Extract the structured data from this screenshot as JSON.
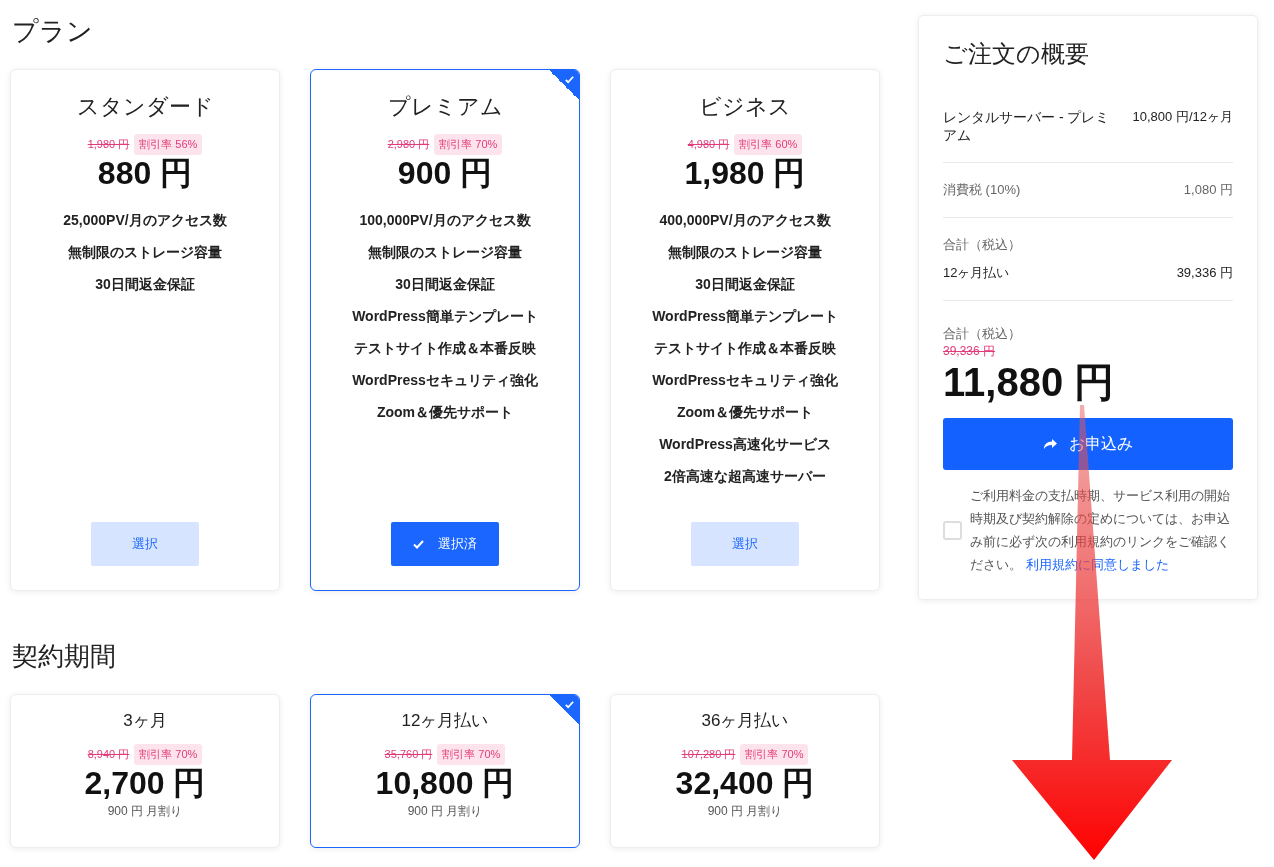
{
  "plan_section": {
    "title": "プラン",
    "plans": [
      {
        "name": "スタンダード",
        "old_price": "1,980 円",
        "discount": "割引率 56%",
        "price": "880 円",
        "features": [
          "25,000PV/月のアクセス数",
          "無制限のストレージ容量",
          "30日間返金保証"
        ],
        "button": "選択",
        "selected": false
      },
      {
        "name": "プレミアム",
        "old_price": "2,980 円",
        "discount": "割引率 70%",
        "price": "900 円",
        "features": [
          "100,000PV/月のアクセス数",
          "無制限のストレージ容量",
          "30日間返金保証",
          "WordPress簡単テンプレート",
          "テストサイト作成＆本番反映",
          "WordPressセキュリティ強化",
          "Zoom＆優先サポート"
        ],
        "button": "選択済",
        "selected": true
      },
      {
        "name": "ビジネス",
        "old_price": "4,980 円",
        "discount": "割引率 60%",
        "price": "1,980 円",
        "features": [
          "400,000PV/月のアクセス数",
          "無制限のストレージ容量",
          "30日間返金保証",
          "WordPress簡単テンプレート",
          "テストサイト作成＆本番反映",
          "WordPressセキュリティ強化",
          "Zoom＆優先サポート",
          "WordPress高速化サービス",
          "2倍高速な超高速サーバー"
        ],
        "button": "選択",
        "selected": false
      }
    ]
  },
  "period_section": {
    "title": "契約期間",
    "periods": [
      {
        "name": "3ヶ月",
        "old_price": "8,940 円",
        "discount": "割引率 70%",
        "price": "2,700 円",
        "monthly": "900 円 月割り",
        "selected": false
      },
      {
        "name": "12ヶ月払い",
        "old_price": "35,760 円",
        "discount": "割引率 70%",
        "price": "10,800 円",
        "monthly": "900 円 月割り",
        "selected": true
      },
      {
        "name": "36ヶ月払い",
        "old_price": "107,280 円",
        "discount": "割引率 70%",
        "price": "32,400 円",
        "monthly": "900 円 月割り",
        "selected": false
      }
    ]
  },
  "summary": {
    "title": "ご注文の概要",
    "item_name": "レンタルサーバー - プレミアム",
    "item_price": "10,800 円/12ヶ月",
    "tax_label": "消費税 (10%)",
    "tax_value": "1,080 円",
    "total_label": "合計（税込）",
    "payment_label": "12ヶ月払い",
    "payment_value": "39,336 円",
    "grand_label": "合計（税込）",
    "grand_old": "39,336 円",
    "grand_total": "11,880 円",
    "submit": "お申込み",
    "agreement": {
      "checked": false,
      "text": "ご利用料金の支払時期、サービス利用の開始時期及び契約解除の定めについては、お申込み前に必ず次の利用規約のリンクをご確認ください。",
      "link": "利用規約に同意しました"
    }
  }
}
